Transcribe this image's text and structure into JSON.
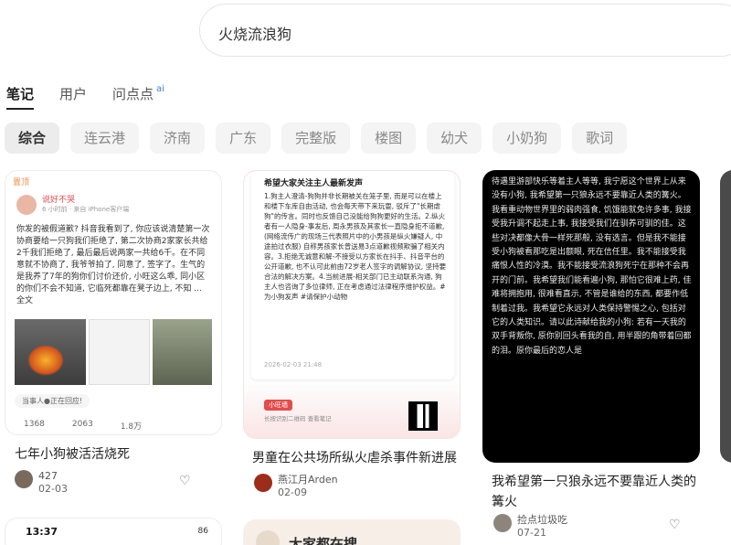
{
  "search": {
    "query": "火烧流浪狗"
  },
  "tabs": [
    {
      "label": "笔记",
      "active": true
    },
    {
      "label": "用户"
    },
    {
      "label": "问点点",
      "badge": "ai"
    }
  ],
  "filters": [
    "综合",
    "连云港",
    "济南",
    "广东",
    "完整版",
    "楼图",
    "幼犬",
    "小奶狗",
    "歌词"
  ],
  "cards": [
    {
      "title": "七年小狗被活活烧死",
      "author": "427",
      "date": "02-03",
      "image": {
        "tag": "置顶",
        "user": "说好不哭",
        "user_sub": "6 小时前 · 来自 iPhone客户端",
        "body": "你发的被假道歉? 抖音我看到了, 你应该说清楚第一次协商要给一只狗我们拒绝了, 第二次协商2家家长共给2千我们拒绝了, 最后最后说两家一共给6千。在不同意就不协商了, 我爷爷拍了, 同意了, 签字了。生气的是我养了7年的狗你们讨价还价, 小旺这么乖, 同小区的你们不会不知道, 它临死都靠在凳子边上, 不知 ... 全文",
        "comment": "当事人●正在回应!",
        "likes": "1368",
        "collects": "2063",
        "comments": "1.8万"
      }
    },
    {
      "title": "男童在公共场所纵火虐杀事件新进展",
      "author": "燕江月Arden",
      "date": "02-09",
      "image": {
        "heading": "希望大家关注主人最新发声",
        "body": "1.狗主人澄清-狗狗并非长期被关在笼子里, 而是可以在楼上和楼下车库自由活动, 也会每天带下来玩耍, 驳斥了\"长期虐狗\"的传言。同时也反馈自己没能给狗狗更好的生活。2.纵火者有一人隐身-事发后, 周永男孩及其家长一直隐身拒不道歉, (网络流传广的现场三代表照片中的小男孩是纵火嫌疑人, 中途拍过衣服) 自称男孩家长曾送易3点道歉视频欺骗了相关内容。3.拒绝无诚意和解-不接受以方家长在抖手、抖音平台的公开道歉, 也不认可此前由72岁老人签字的调解协议, 坚持要合法的解决方案。4.当前进展-相关部门已主动联系沟通, 狗主人也咨询了多位律师, 正在考虑通过法律程序维护权益。#为小狗发声 #请保护小动物",
        "footer": "2026-02-03 21:48",
        "badge": "小旺墙",
        "note": "长按识别二维码 查看笔记"
      }
    },
    {
      "title": "我希望第一只狼永远不要靠近人类的篝火",
      "author": "捡点垃圾吃",
      "date": "07-21",
      "image": {
        "body": "待遇里游部快乐等着主人等等, 我宁愿这个世界上从来没有小狗, 我希望第一只狼永远不要靠近人类的篝火。我看重动物世界里的弱肉强食, 饥饿能就免许多事, 我接受我升调不起走上事, 我接受我们在驯养可驯的佳。这些对决都像大骨一样死那般, 没有选言。但是我不能接受小狗被看那吃是出额眼, 死在信任里。我不能接受我痛恨人性的冷漠。我不能接受流浪狗死宁在那种不会再开的门前。我希望我们能看遍小狗, 那怕它很难上药, 佳难将拥抱用, 很难看直示, 不管是谁给的东西, 都要作低制着过我。我希望它永远对人类保持警惕之心, 包括对它的人类知识。请以此诗献给我的小狗: 若有一天我的双手背叛你, 原你别回头看我的自, 用半跟的角带着回都的泪。原你最后的恋人是"
      }
    },
    {
      "partial": true
    },
    {
      "partial": true,
      "image": {
        "time": "13:37",
        "status": "86"
      }
    },
    {
      "partial": true,
      "image": {
        "text": "大家都在搜"
      }
    }
  ]
}
